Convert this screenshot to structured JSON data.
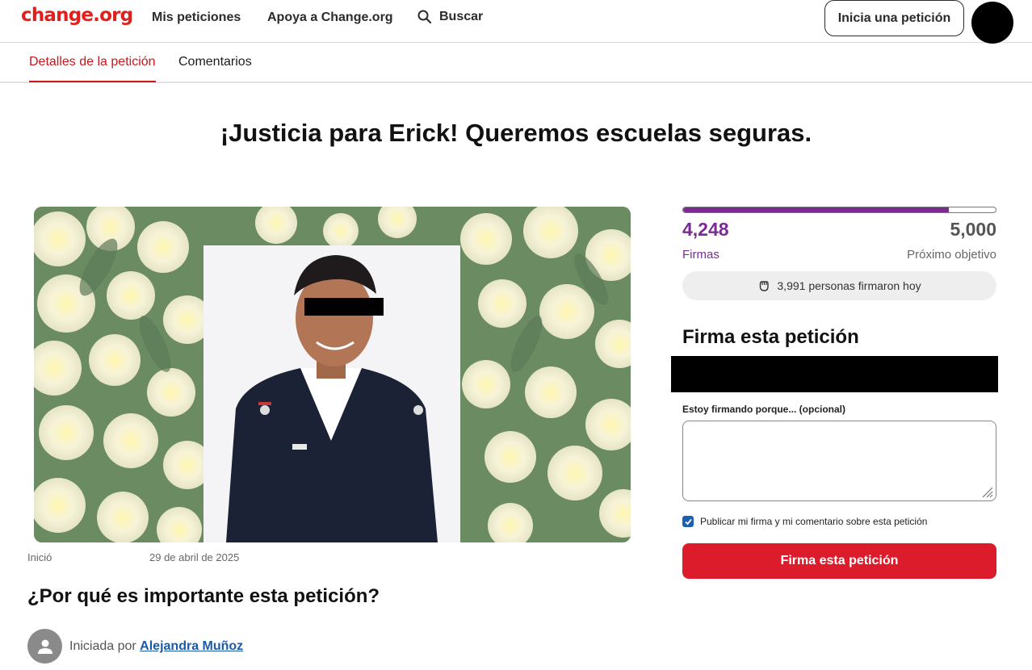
{
  "header": {
    "logo": "change.org",
    "nav": [
      "Mis peticiones",
      "Apoya a Change.org"
    ],
    "search_label": "Buscar",
    "start_button": "Inicia una petición"
  },
  "tabs": [
    {
      "label": "Detalles de la petición",
      "active": true
    },
    {
      "label": "Comentarios",
      "active": false
    }
  ],
  "petition": {
    "title": "¡Justicia para Erick! Queremos escuelas seguras.",
    "started_label": "Inició",
    "started_date": "29 de abril de 2025",
    "why_heading": "¿Por qué es importante esta petición?",
    "author_prefix": "Iniciada por",
    "author_name": "Alejandra Muñoz"
  },
  "signatures": {
    "count": "4,248",
    "count_label": "Firmas",
    "goal": "5,000",
    "goal_label": "Próximo objetivo",
    "progress_fraction": 0.85,
    "today_text": "3,991 personas firmaron hoy"
  },
  "sign_form": {
    "heading": "Firma esta petición",
    "reason_label": "Estoy firmando porque... (opcional)",
    "reason_value": "",
    "publish_label": "Publicar mi firma y mi comentario sobre esta petición",
    "publish_checked": true,
    "submit_label": "Firma esta petición"
  },
  "colors": {
    "brand_red": "#e0201c",
    "progress_purple": "#7a2c92",
    "button_red": "#dd1c2b",
    "link_blue": "#1b5aa8"
  }
}
